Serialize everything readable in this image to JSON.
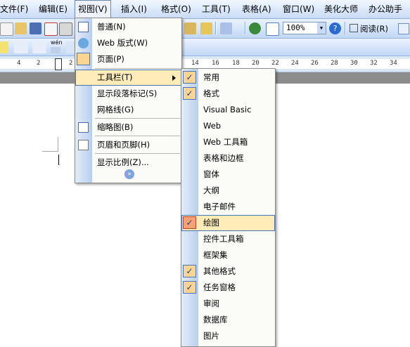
{
  "menubar": {
    "items": [
      "文件(F)",
      "编辑(E)",
      "视图(V)",
      "插入(I)",
      "格式(O)",
      "工具(T)",
      "表格(A)",
      "窗口(W)",
      "美化大师",
      "办公助手"
    ]
  },
  "toolbar": {
    "zoom_value": "100%",
    "read_label": "阅读(R)",
    "font_sample_label": "wén"
  },
  "ruler": {
    "numbers": [
      "4",
      "2",
      "2",
      "14",
      "16",
      "18",
      "20",
      "22",
      "24",
      "26",
      "28",
      "30",
      "32",
      "34"
    ]
  },
  "view_menu": {
    "items": [
      "普通(N)",
      "Web 版式(W)",
      "页面(P)",
      "工具栏(T)",
      "显示段落标记(S)",
      "网格线(G)",
      "缩略图(B)",
      "页眉和页脚(H)",
      "显示比例(Z)..."
    ]
  },
  "toolbars_submenu": {
    "items": [
      {
        "label": "常用",
        "checked": true
      },
      {
        "label": "格式",
        "checked": true
      },
      {
        "label": "Visual Basic",
        "checked": false
      },
      {
        "label": "Web",
        "checked": false
      },
      {
        "label": "Web 工具箱",
        "checked": false
      },
      {
        "label": "表格和边框",
        "checked": false
      },
      {
        "label": "窗体",
        "checked": false
      },
      {
        "label": "大纲",
        "checked": false
      },
      {
        "label": "电子邮件",
        "checked": false
      },
      {
        "label": "绘图",
        "checked": true
      },
      {
        "label": "控件工具箱",
        "checked": false
      },
      {
        "label": "框架集",
        "checked": false
      },
      {
        "label": "其他格式",
        "checked": true
      },
      {
        "label": "任务窗格",
        "checked": true
      },
      {
        "label": "审阅",
        "checked": false
      },
      {
        "label": "数据库",
        "checked": false
      },
      {
        "label": "图片",
        "checked": false
      }
    ]
  },
  "colors": {
    "highlight": "#fdebb8",
    "check_bg": "#fad592",
    "check_active": "#f7a074",
    "menubar": "#c8dbf6"
  }
}
